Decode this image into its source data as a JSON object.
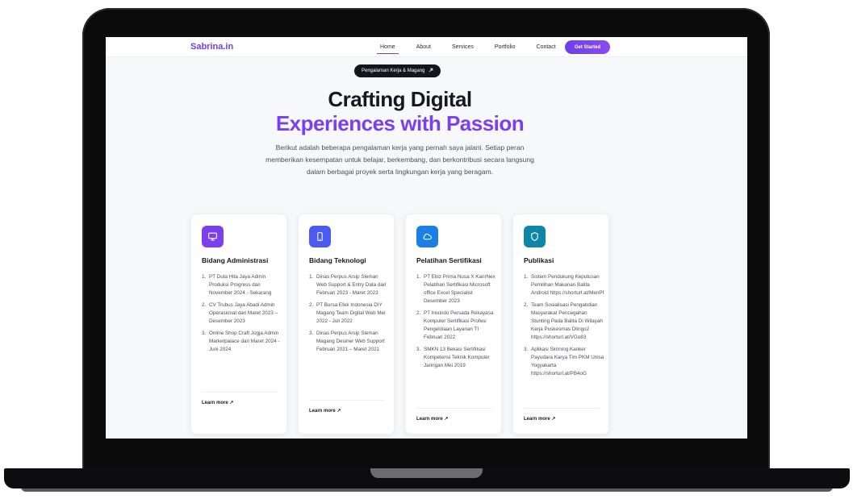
{
  "navbar": {
    "brand": "Sabrina.in",
    "links": [
      "Home",
      "About",
      "Services",
      "Portfolio",
      "Contact"
    ],
    "active": "Home",
    "cta": "Get Started"
  },
  "hero": {
    "badge": "Pengalaman Kerja & Magang",
    "badge_icon": "arrow-up-right-icon",
    "title_line1": "Crafting Digital",
    "title_line2": "Experiences with Passion",
    "description": "Berikut adalah beberapa pengalaman kerja yang pernah saya jalani. Setiap peran memberikan kesempatan untuk belajar, berkembang, dan berkontribusi secara langsung dalam berbagai proyek serta lingkungan kerja yang beragam."
  },
  "cards": [
    {
      "icon": "monitor-icon",
      "icon_color": "#7b3ff0",
      "title": "Bidang Administrasi",
      "items": [
        "PT Duta Hita Jaya Admin Produksi Progress dari November 2024 - Sekarang",
        "CV Trubus Jaya Abadi Admin Operasional dari Maret 2023 – Desember 2023",
        "Online Shop Craft Jogja Admin Marketpalace dari Maret 2024 - Juni 2024"
      ],
      "link": "Learn more"
    },
    {
      "icon": "smartphone-icon",
      "icon_color": "#4a5cf0",
      "title": "Bidang Teknologi",
      "items": [
        "Dinas Perpus Arsip Sleman Web Support & Entry Data dari Februari 2023 - Maret 2023",
        "PT Bursa Efek Indonesia DIY Magang Team Digital Web Mei 2022 - Juli 2022",
        "Dinas Perpus Arsip Sleman Magang Desiner Web Support Februari 2021 – Maret 2021"
      ],
      "link": "Learn more"
    },
    {
      "icon": "cloud-icon",
      "icon_color": "#1a7fe6",
      "title": "Pelatihan Sertifikasi",
      "items": [
        "PT Ebiz Prima Nusa X KarirNex Pelatihan Sertifikasi Microsoft office Excel Specialist Desember 2023",
        "PT Inixindo Persada Rekayasa Komputer Sertifikasi Profesi Pengelolaan Layanan TI Februari 2022",
        "SMKN 13 Bekasi Sertifikasi Kompetensi Teknik Komputer Jaringan Mei 2019"
      ],
      "link": "Learn more"
    },
    {
      "icon": "shield-icon",
      "icon_color": "#0e86a8",
      "title": "Publikasi",
      "items": [
        "Sistem Pendukung Keputusan Pemilihan Makanan Balita Android https://shorturl.at/MenPf",
        "Team Sosialisasi Pengabdian Masyarakat Pencegahan Stunting Pada Balita Di Wilayah Kerja Puskesmas Dlingo2 https://shorturl.at/VGo83",
        "Aplikasi Skrining Kanker Payudara Karya Tim PKM Unisa Yogyakarta https://shorturl.at/PB4oG"
      ],
      "link": "Learn more"
    }
  ]
}
